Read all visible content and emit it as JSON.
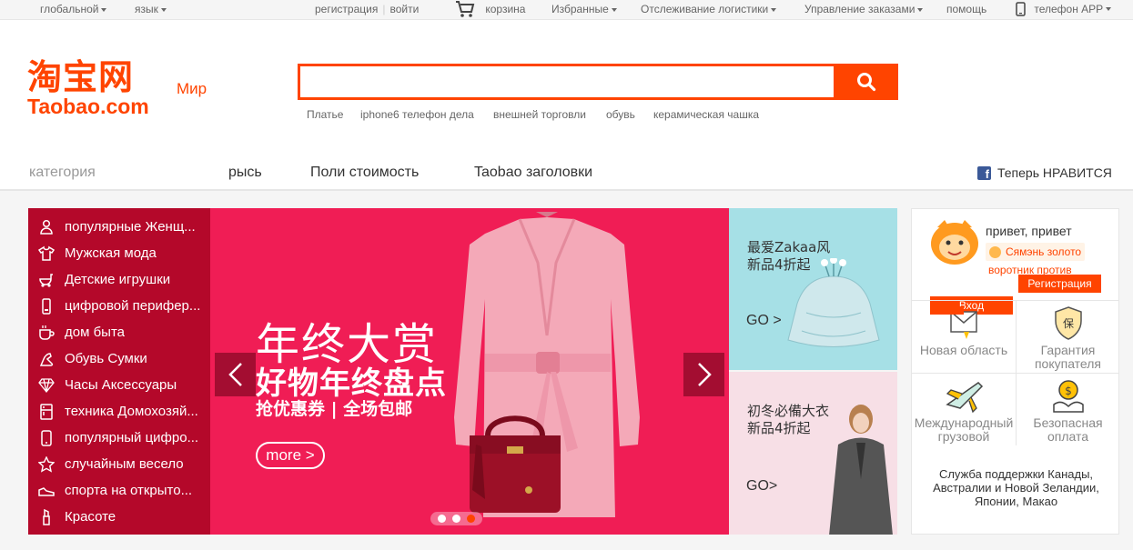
{
  "topbar": {
    "global": "глобальной",
    "language": "язык",
    "register": "регистрация",
    "login": "войти",
    "cart": "корзина",
    "favorites": "Избранные",
    "tracking": "Отслеживание логистики",
    "orders": "Управление заказами",
    "help": "помощь",
    "phone_app": "телефон APP"
  },
  "header": {
    "logo_cn": "淘宝网",
    "logo_en": "Taobao.com",
    "logo_region": "Мир",
    "search": {
      "value": "",
      "placeholder": ""
    },
    "hot_searches": [
      "Платье",
      "iphone6 телефон дела",
      "внешней торговли",
      "обувь",
      "керамическая чашка"
    ]
  },
  "nav": {
    "category": "категория",
    "items": [
      "рысь",
      "Поли стоимость",
      "Taobao заголовки"
    ],
    "facebook_icon": "f",
    "facebook_like": "Теперь НРАВИТСЯ"
  },
  "categories": [
    {
      "icon": "woman-icon",
      "label": "популярные Женщ..."
    },
    {
      "icon": "shirt-icon",
      "label": "Мужская мода"
    },
    {
      "icon": "stroller-icon",
      "label": "Детские игрушки"
    },
    {
      "icon": "phone-icon",
      "label": "цифровой перифер..."
    },
    {
      "icon": "cup-icon",
      "label": "дом быта"
    },
    {
      "icon": "shoe-icon",
      "label": "Обувь Сумки"
    },
    {
      "icon": "diamond-icon",
      "label": "Часы Аксессуары"
    },
    {
      "icon": "appliance-icon",
      "label": "техника Домохозяй..."
    },
    {
      "icon": "mobile-icon",
      "label": "популярный цифро..."
    },
    {
      "icon": "star-icon",
      "label": "случайным весело"
    },
    {
      "icon": "sneaker-icon",
      "label": "спорта на открыто..."
    },
    {
      "icon": "lipstick-icon",
      "label": "Красоте"
    }
  ],
  "banner": {
    "title_line1": "年终大赏",
    "title_line2": "好物年终盘点",
    "title_line3": "抢优惠券 | 全场包邮",
    "more": "more >",
    "slides": 3,
    "active_slide": 3
  },
  "promos": [
    {
      "text": "最爱Zakaa风\n新品4折起",
      "go": "GO >"
    },
    {
      "text": "初冬必備大衣\n新品4折起",
      "go": "GO>"
    }
  ],
  "user": {
    "greeting": "привет, привет",
    "gold": "Сямэнь золото",
    "collar": "воротник против",
    "login": "Вход",
    "register": "Регистрация",
    "services": [
      {
        "icon": "new-icon",
        "label": "Новая область"
      },
      {
        "icon": "shield-icon",
        "label": "Гарантия покупателя"
      },
      {
        "icon": "plane-icon",
        "label": "Международный грузовой"
      },
      {
        "icon": "money-hand-icon",
        "label": "Безопасная оплата"
      }
    ],
    "support": "Служба поддержки Канады, Австралии и Новой Зеландии, Японии, Макао"
  },
  "colors": {
    "brand": "#ff4400",
    "sidebar": "#b4082a",
    "banner": "#f01d55",
    "promo1": "#a6e0e6",
    "promo2": "#f7dfe6"
  }
}
